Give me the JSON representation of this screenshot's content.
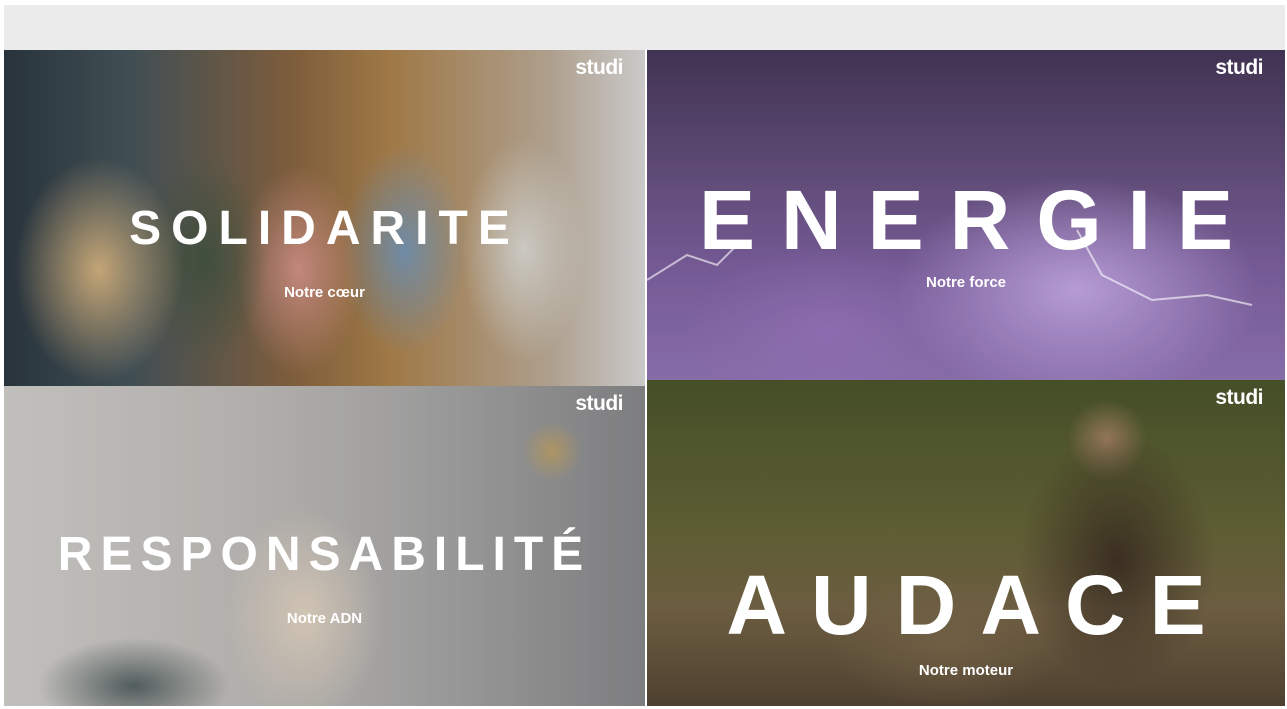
{
  "brand": {
    "logo_text": "studi"
  },
  "tiles": [
    {
      "title": "SOLIDARITE",
      "subtitle": "Notre cœur"
    },
    {
      "title": "ENERGIE",
      "subtitle": "Notre force"
    },
    {
      "title": "RESPONSABILITÉ",
      "subtitle": "Notre ADN"
    },
    {
      "title": "AUDACE",
      "subtitle": "Notre moteur"
    }
  ]
}
